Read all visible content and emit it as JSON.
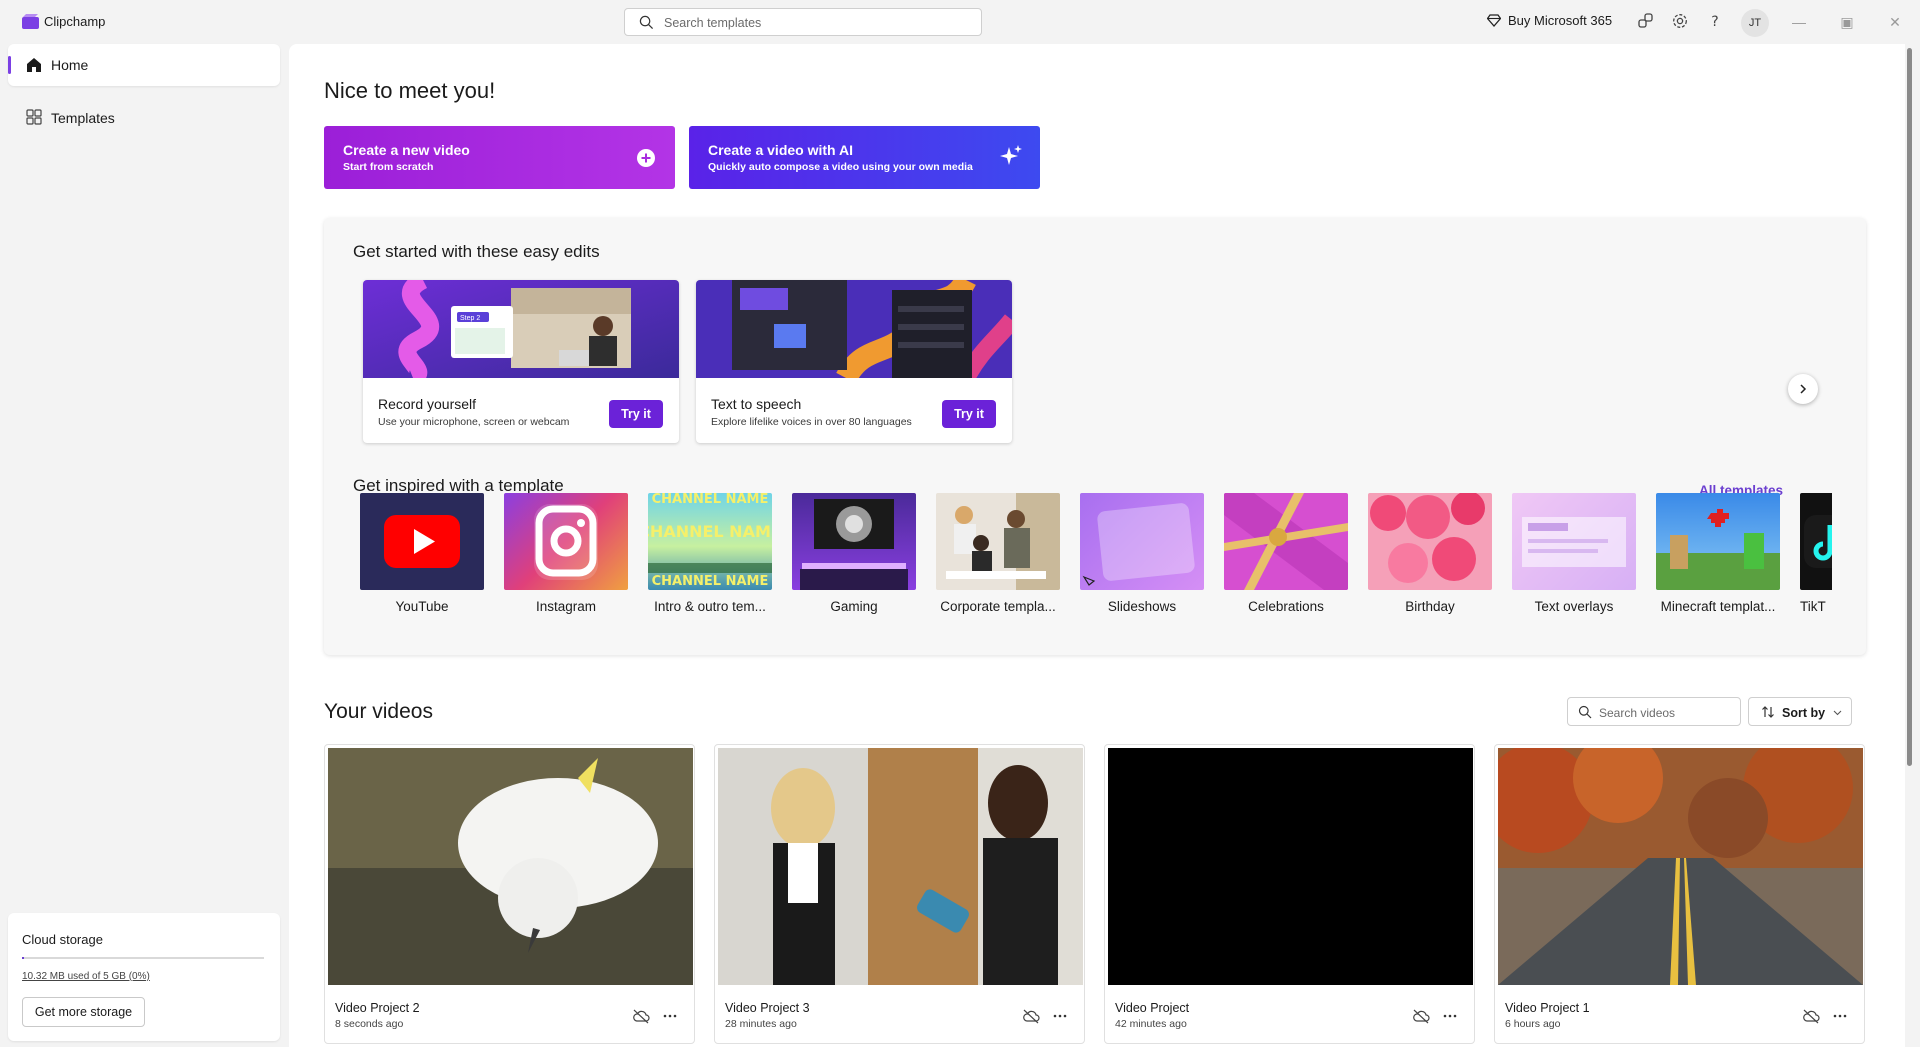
{
  "app": {
    "name": "Clipchamp"
  },
  "titlebar": {
    "search_placeholder": "Search templates",
    "buy_label": "Buy Microsoft 365",
    "avatar_initials": "JT",
    "icons": [
      "diamond-icon",
      "share-icon",
      "gear-icon",
      "help-icon"
    ]
  },
  "sidebar": {
    "items": [
      {
        "label": "Home",
        "icon": "home-icon",
        "active": true
      },
      {
        "label": "Templates",
        "icon": "templates-icon",
        "active": false
      }
    ],
    "storage": {
      "title": "Cloud storage",
      "used_text": "10.32 MB used of 5 GB (0%)",
      "used_fraction": 0.002,
      "button": "Get more storage"
    }
  },
  "main": {
    "greeting": "Nice to meet you!",
    "cta": [
      {
        "title": "Create a new video",
        "subtitle": "Start from scratch",
        "icon": "plus-circle-icon"
      },
      {
        "title": "Create a video with AI",
        "subtitle": "Quickly auto compose a video using your own media",
        "icon": "sparkle-icon"
      }
    ],
    "easy_edits": {
      "title": "Get started with these easy edits",
      "items": [
        {
          "title": "Record yourself",
          "subtitle": "Use your microphone, screen or webcam",
          "button": "Try it",
          "thumb_text": "Step 2"
        },
        {
          "title": "Text to speech",
          "subtitle": "Explore lifelike voices in over 80 languages",
          "button": "Try it"
        }
      ]
    },
    "templates": {
      "title": "Get inspired with a template",
      "all_link": "All templates",
      "items": [
        {
          "label": "YouTube"
        },
        {
          "label": "Instagram"
        },
        {
          "label": "Intro & outro tem...",
          "thumb_text": "CHANNEL NAME"
        },
        {
          "label": "Gaming"
        },
        {
          "label": "Corporate templa..."
        },
        {
          "label": "Slideshows"
        },
        {
          "label": "Celebrations"
        },
        {
          "label": "Birthday"
        },
        {
          "label": "Text overlays"
        },
        {
          "label": "Minecraft templat..."
        },
        {
          "label": "TikT"
        }
      ]
    },
    "videos": {
      "title": "Your videos",
      "search_placeholder": "Search videos",
      "sort_label": "Sort by",
      "items": [
        {
          "title": "Video Project 2",
          "subtitle": "8 seconds ago"
        },
        {
          "title": "Video Project 3",
          "subtitle": "28 minutes ago"
        },
        {
          "title": "Video Project",
          "subtitle": "42 minutes ago"
        },
        {
          "title": "Video Project 1",
          "subtitle": "6 hours ago"
        }
      ]
    }
  },
  "colors": {
    "accent": "#6b22d8",
    "cta_new": "#a82be0",
    "cta_ai": "#4a36ec",
    "link": "#6b3fd0"
  }
}
